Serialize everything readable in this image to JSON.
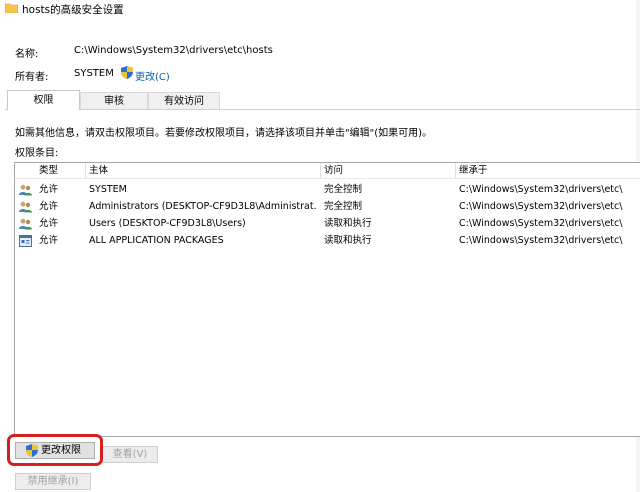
{
  "window": {
    "title": "hosts的高级安全设置"
  },
  "info": {
    "name_label": "名称:",
    "name_value": "C:\\Windows\\System32\\drivers\\etc\\hosts",
    "owner_label": "所有者:",
    "owner_value": "SYSTEM",
    "change_owner_link": "更改(C)"
  },
  "tabs": [
    {
      "label": "权限",
      "active": true
    },
    {
      "label": "审核",
      "active": false
    },
    {
      "label": "有效访问",
      "active": false
    }
  ],
  "instructions": "如需其他信息，请双击权限项目。若要修改权限项目，请选择该项目并单击\"编辑\"(如果可用)。",
  "entries_label": "权限条目:",
  "table": {
    "headers": [
      "类型",
      "主体",
      "访问",
      "继承于"
    ],
    "rows": [
      {
        "icon": "users-icon",
        "type": "允许",
        "principal": "SYSTEM",
        "access": "完全控制",
        "inherited": "C:\\Windows\\System32\\drivers\\etc\\"
      },
      {
        "icon": "users-icon",
        "type": "允许",
        "principal": "Administrators (DESKTOP-CF9D3L8\\Administrat...",
        "access": "完全控制",
        "inherited": "C:\\Windows\\System32\\drivers\\etc\\"
      },
      {
        "icon": "users-icon",
        "type": "允许",
        "principal": "Users (DESKTOP-CF9D3L8\\Users)",
        "access": "读取和执行",
        "inherited": "C:\\Windows\\System32\\drivers\\etc\\"
      },
      {
        "icon": "package-icon",
        "type": "允许",
        "principal": "ALL APPLICATION PACKAGES",
        "access": "读取和执行",
        "inherited": "C:\\Windows\\System32\\drivers\\etc\\"
      }
    ]
  },
  "buttons": {
    "change_permissions": "更改权限",
    "view": "查看(V)",
    "disable_inheritance": "禁用继承(I)"
  },
  "colors": {
    "highlight": "#d42020",
    "link": "#0b5fb5"
  }
}
